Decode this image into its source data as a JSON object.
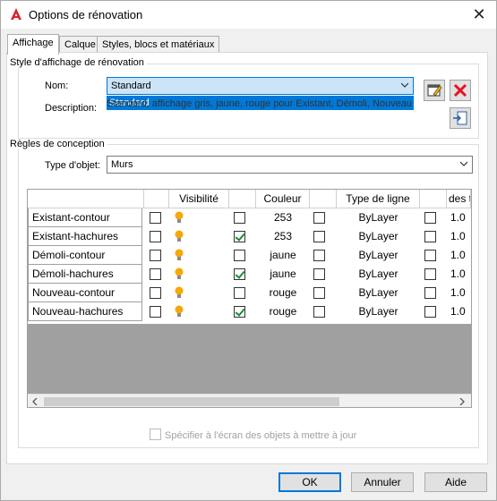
{
  "window": {
    "title": "Options de rénovation",
    "close_glyph": "✕"
  },
  "tabs": [
    {
      "label": "Affichage"
    },
    {
      "label": "Calque"
    },
    {
      "label": "Styles, blocs et matériaux"
    }
  ],
  "style_group": {
    "title": "Style d'affichage de rénovation",
    "name_label": "Nom:",
    "name_value": "Standard",
    "dropdown_option": "Standard",
    "description_label": "Description:",
    "description_value": "Standard, affichage gris, jaune, rouge pour Existant, Démoli, Nouveau"
  },
  "rules_group": {
    "title": "Règles de conception",
    "object_type_label": "Type d'objet:",
    "object_type_value": "Murs"
  },
  "grid": {
    "headers": [
      "Visibilité",
      "Couleur",
      "Type de ligne",
      "des ty"
    ],
    "rows": [
      {
        "name": "Existant-contour",
        "c1": false,
        "c2": false,
        "color": "253",
        "c3": false,
        "linetype": "ByLayer",
        "c4": false,
        "weight": "1.0"
      },
      {
        "name": "Existant-hachures",
        "c1": false,
        "c2": true,
        "color": "253",
        "c3": false,
        "linetype": "ByLayer",
        "c4": false,
        "weight": "1.0"
      },
      {
        "name": "Démoli-contour",
        "c1": false,
        "c2": false,
        "color": "jaune",
        "c3": false,
        "linetype": "ByLayer",
        "c4": false,
        "weight": "1.0"
      },
      {
        "name": "Démoli-hachures",
        "c1": false,
        "c2": true,
        "color": "jaune",
        "c3": false,
        "linetype": "ByLayer",
        "c4": false,
        "weight": "1.0"
      },
      {
        "name": "Nouveau-contour",
        "c1": false,
        "c2": false,
        "color": "rouge",
        "c3": false,
        "linetype": "ByLayer",
        "c4": false,
        "weight": "1.0"
      },
      {
        "name": "Nouveau-hachures",
        "c1": false,
        "c2": true,
        "color": "rouge",
        "c3": false,
        "linetype": "ByLayer",
        "c4": false,
        "weight": "1.0"
      }
    ]
  },
  "specify_checkbox_label": "Spécifier à l'écran des objets à mettre à jour",
  "buttons": {
    "ok": "OK",
    "cancel": "Annuler",
    "help": "Aide"
  },
  "colors": {
    "accent": "#0078d7",
    "bulb": "#f5a800",
    "delete_red": "#e81123"
  }
}
